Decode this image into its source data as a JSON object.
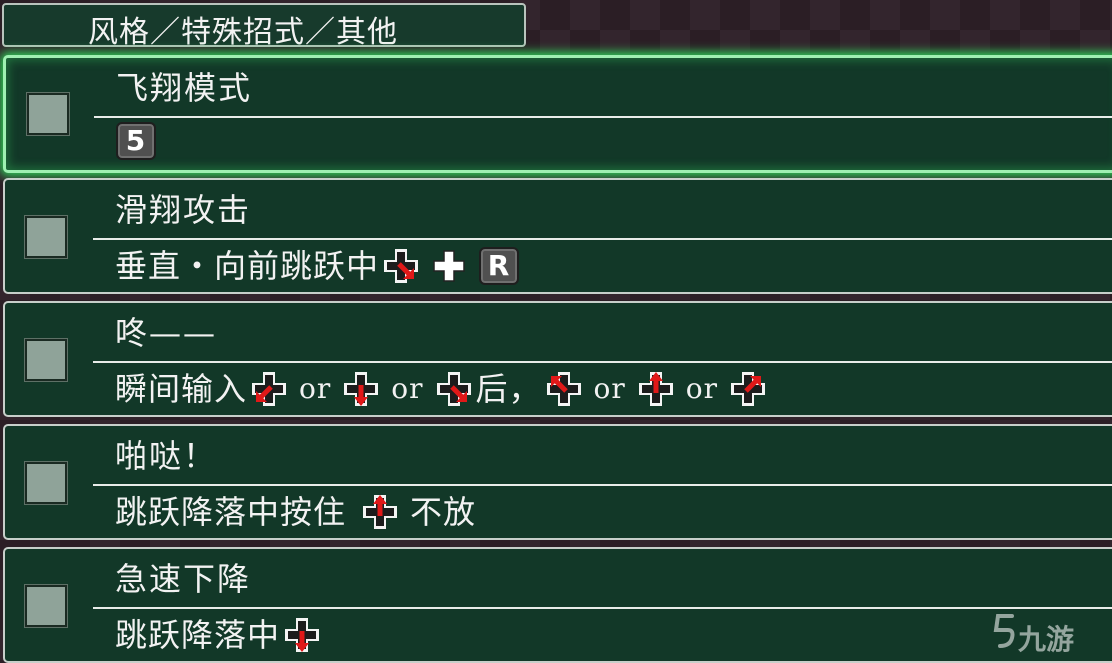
{
  "category": {
    "label": "风格／特殊招式／其他"
  },
  "moves": [
    {
      "title": "飞翔模式",
      "key": "5"
    },
    {
      "title": "滑翔攻击",
      "desc": "垂直・向前跳跃中",
      "key": "R"
    },
    {
      "title": "咚——",
      "desc_pre": "瞬间输入",
      "or": "or",
      "desc_mid": "后，"
    },
    {
      "title": "啪哒！",
      "desc_pre": "跳跃降落中按住",
      "desc_post": "不放"
    },
    {
      "title": "急速下降",
      "desc": "跳跃降落中"
    }
  ],
  "watermark": "九游",
  "colors": {
    "row_bg": "#123828",
    "selected_glow": "#2fd35a",
    "arrow": "#e01818"
  }
}
